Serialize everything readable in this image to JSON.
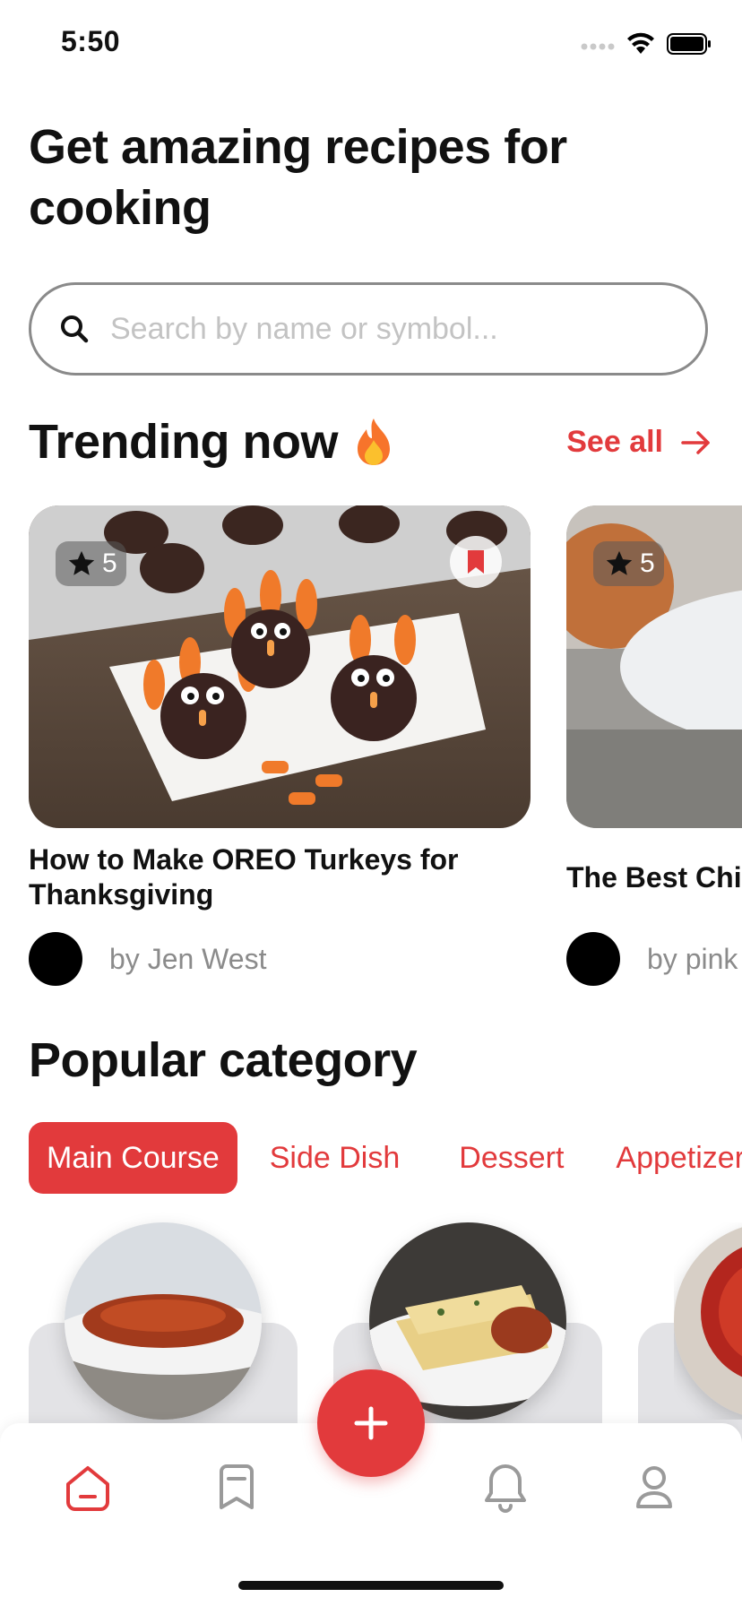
{
  "status_bar": {
    "time": "5:50"
  },
  "headline": "Get amazing recipes for cooking",
  "search": {
    "placeholder": "Search by name or symbol..."
  },
  "trending": {
    "title": "Trending now",
    "see_all": "See all",
    "cards": [
      {
        "rating": "5",
        "title": "How to Make OREO Turkeys for Thanksgiving",
        "author": "by Jen West",
        "bookmarked": true
      },
      {
        "rating": "5",
        "title": "The Best Chil",
        "author": "by pink"
      }
    ]
  },
  "popular": {
    "title": "Popular category",
    "categories": [
      "Main Course",
      "Side Dish",
      "Dessert",
      "Appetizer"
    ],
    "selected": "Main Course"
  },
  "colors": {
    "accent": "#e23a3c",
    "muted": "#8b8b8b",
    "card_bg": "#e3e3e6"
  },
  "nav": {
    "items": [
      "home-icon",
      "bookmark-icon",
      "add-icon",
      "bell-icon",
      "profile-icon"
    ],
    "active": "home-icon"
  }
}
